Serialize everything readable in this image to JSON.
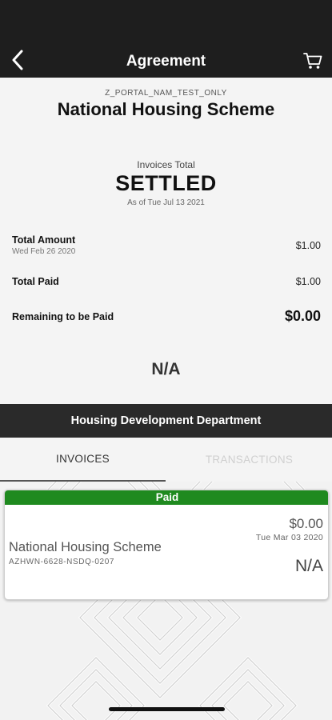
{
  "nav": {
    "title": "Agreement",
    "back_icon": "chevron-left-icon",
    "cart_icon": "cart-icon"
  },
  "agreement": {
    "portal_code": "Z_PORTAL_NAM_TEST_ONLY",
    "title": "National Housing Scheme"
  },
  "invoices_total": {
    "label": "Invoices Total",
    "status": "SETTLED",
    "as_of": "As of Tue Jul 13 2021"
  },
  "summary": {
    "total_amount_label": "Total Amount",
    "total_amount_date": "Wed Feb 26 2020",
    "total_amount_value": "$1.00",
    "total_paid_label": "Total Paid",
    "total_paid_value": "$1.00",
    "remaining_label": "Remaining to be Paid",
    "remaining_value": "$0.00",
    "extra_value": "N/A"
  },
  "department": {
    "title": "Housing Development Department"
  },
  "tabs": [
    {
      "label": "INVOICES",
      "active": true
    },
    {
      "label": "TRANSACTIONS",
      "active": false
    }
  ],
  "invoice_card": {
    "status": "Paid",
    "amount": "$0.00",
    "date": "Tue Mar 03 2020",
    "title": "National Housing Scheme",
    "reference": "AZHWN-6628-NSDQ-0207",
    "extra": "N/A"
  },
  "colors": {
    "header_bg": "#1e1e1e",
    "dept_bar_bg": "#2a2a2a",
    "paid_badge": "#1f8a1f"
  }
}
